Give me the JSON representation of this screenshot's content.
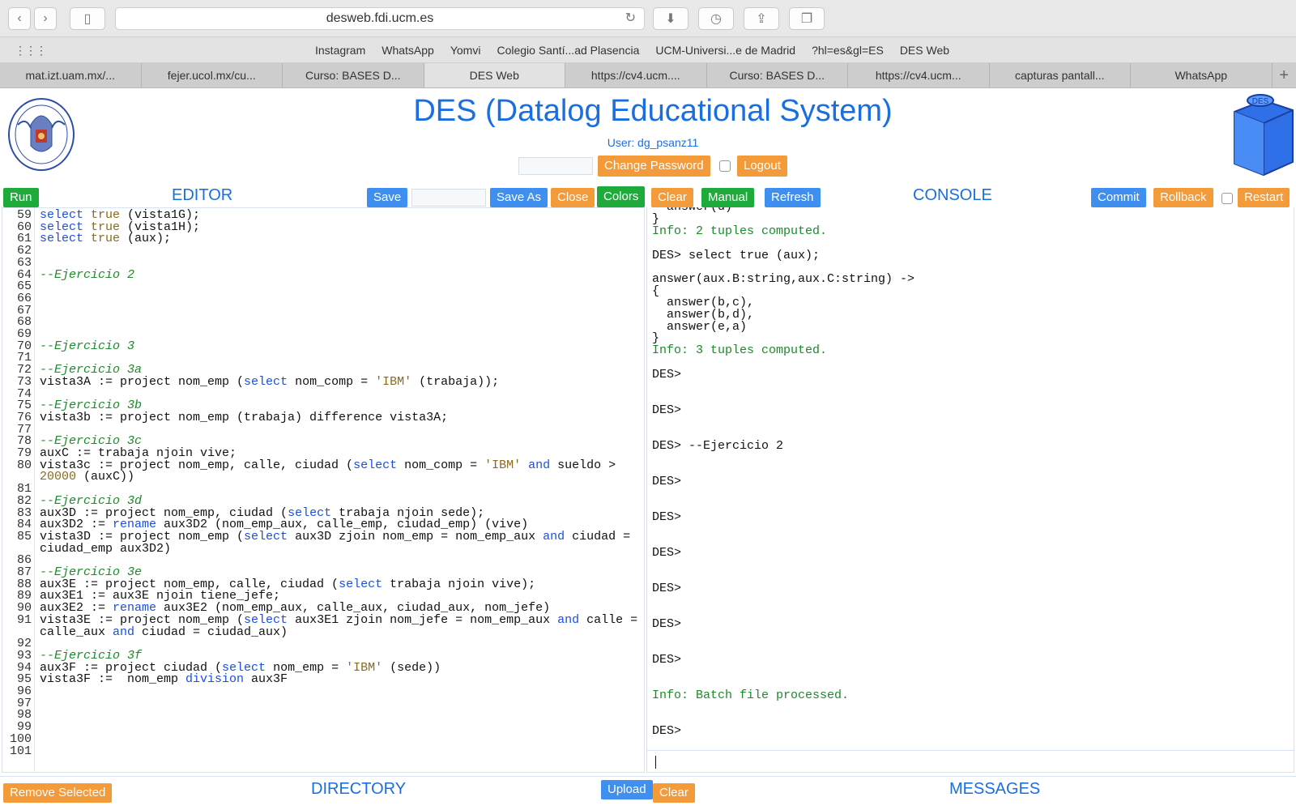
{
  "browser": {
    "url": "desweb.fdi.ucm.es",
    "bookmarks": [
      "Instagram",
      "WhatsApp",
      "Yomvi",
      "Colegio Santí...ad Plasencia",
      "UCM-Universi...e de Madrid",
      "?hl=es&gl=ES",
      "DES Web"
    ],
    "tabs": [
      "mat.izt.uam.mx/...",
      "fejer.ucol.mx/cu...",
      "Curso: BASES D...",
      "DES Web",
      "https://cv4.ucm....",
      "Curso: BASES D...",
      "https://cv4.ucm...",
      "capturas pantall...",
      "WhatsApp"
    ],
    "active_tab": 3
  },
  "header": {
    "title": "DES (Datalog Educational System)",
    "user": "User: dg_psanz11",
    "change_password": "Change Password",
    "logout": "Logout"
  },
  "editor": {
    "run": "Run",
    "title": "EDITOR",
    "save": "Save",
    "save_as": "Save As",
    "close": "Close",
    "colors": "Colors",
    "line_numbers": [
      "59",
      "60",
      "61",
      "62",
      "63",
      "64",
      "65",
      "66",
      "67",
      "68",
      "69",
      "70",
      "71",
      "72",
      "73",
      "74",
      "75",
      "76",
      "77",
      "78",
      "79",
      "80",
      "",
      "81",
      "82",
      "83",
      "84",
      "85",
      "",
      "86",
      "87",
      "88",
      "89",
      "90",
      "91",
      "",
      "92",
      "93",
      "94",
      "95",
      "96",
      "97",
      "98",
      "99",
      "100",
      "101"
    ],
    "code_lines": [
      "select true (vista1G);",
      "select true (vista1H);",
      "select true (aux);",
      "",
      "",
      "--Ejercicio 2",
      "",
      "",
      "",
      "",
      "",
      "--Ejercicio 3",
      "",
      "--Ejercicio 3a",
      "vista3A := project nom_emp (select nom_comp = 'IBM' (trabaja));",
      "",
      "--Ejercicio 3b",
      "vista3b := project nom_emp (trabaja) difference vista3A;",
      "",
      "--Ejercicio 3c",
      "auxC := trabaja njoin vive;",
      "vista3c := project nom_emp, calle, ciudad (select nom_comp = 'IBM' and sueldo >",
      "20000 (auxC))",
      "",
      "--Ejercicio 3d",
      "aux3D := project nom_emp, ciudad (select trabaja njoin sede);",
      "aux3D2 := rename aux3D2 (nom_emp_aux, calle_emp, ciudad_emp) (vive)",
      "vista3D := project nom_emp (select aux3D zjoin nom_emp = nom_emp_aux and ciudad =",
      "ciudad_emp aux3D2)",
      "",
      "--Ejercicio 3e",
      "aux3E := project nom_emp, calle, ciudad (select trabaja njoin vive);",
      "aux3E1 := aux3E njoin tiene_jefe;",
      "aux3E2 := rename aux3E2 (nom_emp_aux, calle_aux, ciudad_aux, nom_jefe)",
      "vista3E := project nom_emp (select aux3E1 zjoin nom_jefe = nom_emp_aux and calle =",
      "calle_aux and ciudad = ciudad_aux)",
      "",
      "--Ejercicio 3f",
      "aux3F := project ciudad (select nom_emp = 'IBM' (sede))",
      "vista3F :=  nom_emp division aux3F",
      "",
      "",
      "",
      "",
      "",
      ""
    ]
  },
  "console": {
    "clear": "Clear",
    "manual": "Manual",
    "refresh": "Refresh",
    "title": "CONSOLE",
    "commit": "Commit",
    "rollback": "Rollback",
    "restart": "Restart",
    "lines": [
      {
        "t": "  answer(d)",
        "c": ""
      },
      {
        "t": "}",
        "c": ""
      },
      {
        "t": "Info: 2 tuples computed.",
        "c": "info"
      },
      {
        "t": "DES> select true (aux);",
        "c": ""
      },
      {
        "t": "answer(aux.B:string,aux.C:string) ->",
        "c": ""
      },
      {
        "t": "{",
        "c": ""
      },
      {
        "t": "  answer(b,c),",
        "c": ""
      },
      {
        "t": "  answer(b,d),",
        "c": ""
      },
      {
        "t": "  answer(e,a)",
        "c": ""
      },
      {
        "t": "}",
        "c": ""
      },
      {
        "t": "Info: 3 tuples computed.",
        "c": "info"
      },
      {
        "t": "DES>",
        "c": ""
      },
      {
        "t": "DES>",
        "c": ""
      },
      {
        "t": "DES> --Ejercicio 2",
        "c": ""
      },
      {
        "t": "DES>",
        "c": ""
      },
      {
        "t": "DES>",
        "c": ""
      },
      {
        "t": "DES>",
        "c": ""
      },
      {
        "t": "DES>",
        "c": ""
      },
      {
        "t": "DES>",
        "c": ""
      },
      {
        "t": "DES>",
        "c": ""
      },
      {
        "t": "Info: Batch file processed.",
        "c": "info"
      },
      {
        "t": "DES>",
        "c": ""
      }
    ]
  },
  "directory": {
    "remove_selected": "Remove Selected",
    "title": "DIRECTORY",
    "upload": "Upload"
  },
  "messages": {
    "clear": "Clear",
    "title": "MESSAGES"
  },
  "colors": {
    "accent_blue": "#1a6fe0",
    "button_orange": "#f39a3a",
    "button_blue": "#3e8ff0",
    "button_green": "#1faa3c"
  }
}
